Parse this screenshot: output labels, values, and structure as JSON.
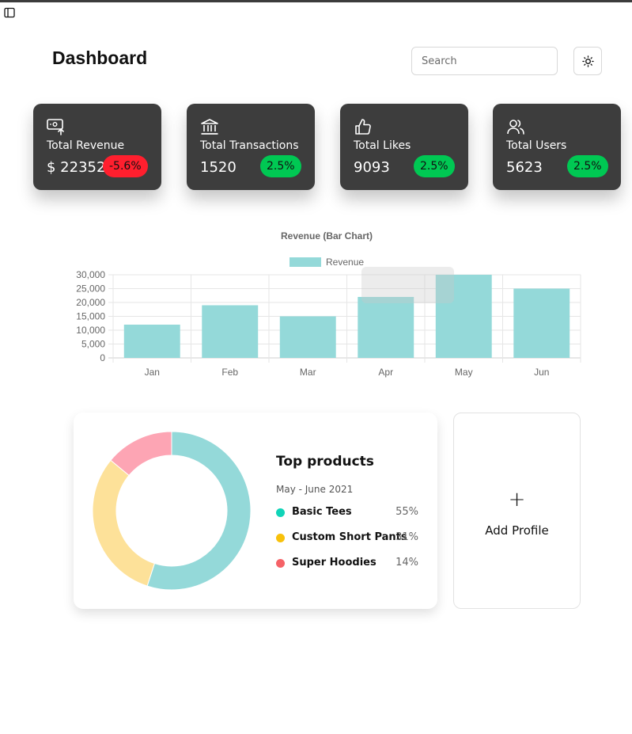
{
  "header": {
    "title": "Dashboard",
    "search_placeholder": "Search",
    "sidebar_toggle_icon": "sidebar-icon",
    "theme_toggle_icon": "sun-icon"
  },
  "stats": [
    {
      "label": "Total Revenue",
      "value": "$ 22352",
      "change": "-5.6%",
      "change_color": "#ff1f2e",
      "icon": "money-icon"
    },
    {
      "label": "Total Transactions",
      "value": "1520",
      "change": "2.5%",
      "change_color": "#00c853",
      "icon": "bank-icon"
    },
    {
      "label": "Total Likes",
      "value": "9093",
      "change": "2.5%",
      "change_color": "#00c853",
      "icon": "thumbs-up-icon"
    },
    {
      "label": "Total Users",
      "value": "5623",
      "change": "2.5%",
      "change_color": "#00c853",
      "icon": "users-icon"
    }
  ],
  "chart_data": [
    {
      "type": "bar",
      "title": "Revenue (Bar Chart)",
      "categories": [
        "Jan",
        "Feb",
        "Mar",
        "Apr",
        "May",
        "Jun"
      ],
      "series": [
        {
          "name": "Revenue",
          "values": [
            12000,
            19000,
            15000,
            22000,
            30000,
            25000
          ],
          "color": "#94d9d9"
        }
      ],
      "ylim": [
        0,
        30000
      ],
      "yticks": [
        "30,000",
        "25,000",
        "20,000",
        "15,000",
        "10,000",
        "5,000",
        "0"
      ],
      "grid": true,
      "legend": "top"
    },
    {
      "type": "pie",
      "title": "Top products",
      "subtitle": "May - June 2021",
      "slices": [
        {
          "label": "Basic Tees",
          "value": 55,
          "pct": "55%",
          "chart_color": "#94d9d9",
          "legend_color": "#10d4b8"
        },
        {
          "label": "Custom Short Pants",
          "value": 31,
          "pct": "31%",
          "chart_color": "#fde199",
          "legend_color": "#f8c10b"
        },
        {
          "label": "Super Hoodies",
          "value": 14,
          "pct": "14%",
          "chart_color": "#fda5b4",
          "legend_color": "#f56267"
        }
      ]
    }
  ],
  "add_profile": {
    "plus": "+",
    "label": "Add Profile"
  }
}
